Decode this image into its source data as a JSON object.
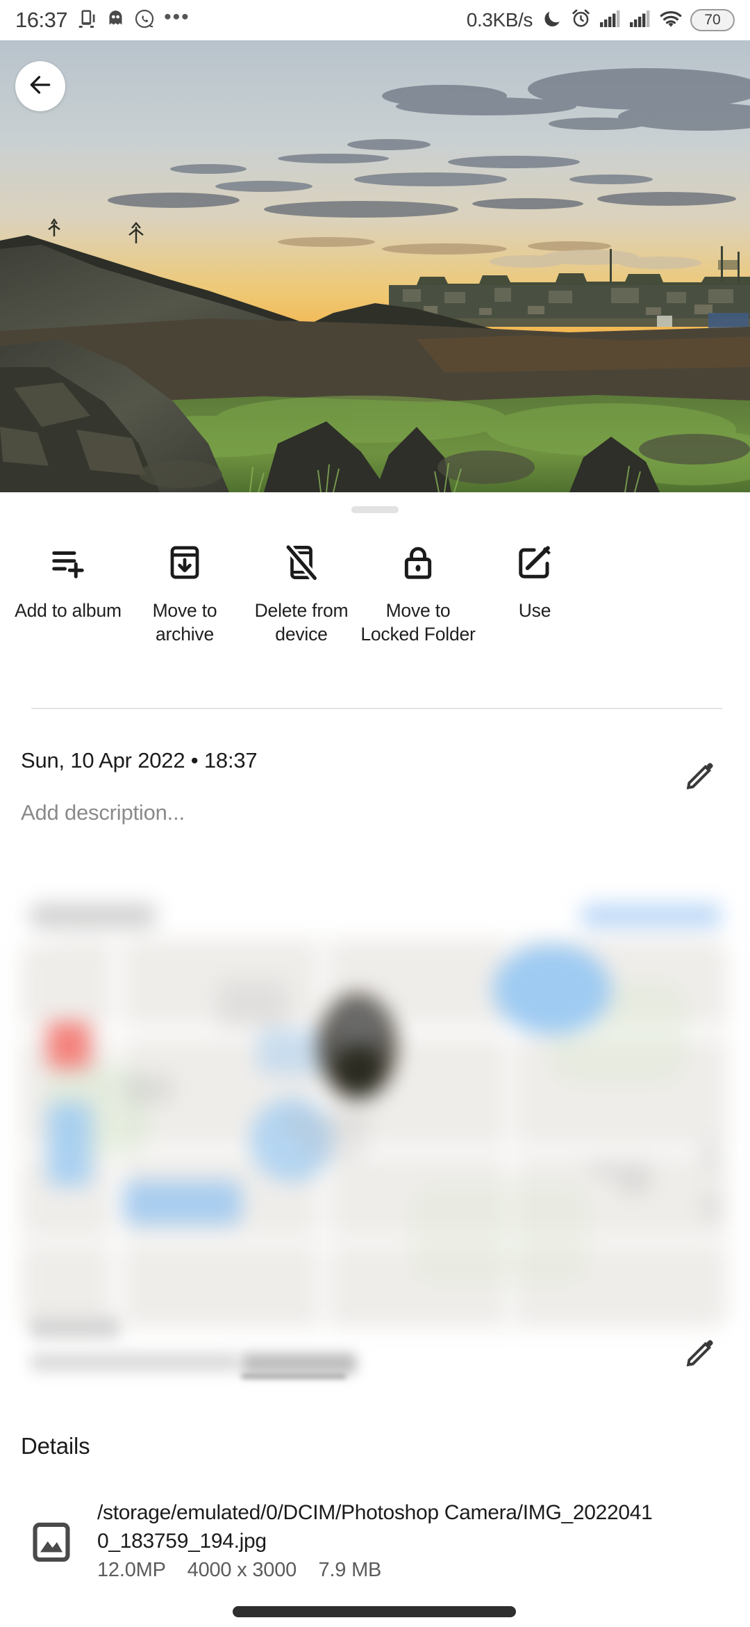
{
  "statusbar": {
    "clock": "16:37",
    "network_speed": "0.3KB/s",
    "battery": "70",
    "icons": [
      "cast-icon",
      "ghost-icon",
      "whatsapp-icon",
      "more-dots-icon",
      "dnd-moon-icon",
      "alarm-clock-icon",
      "signal-bars-sim1-icon",
      "signal-bars-sim2-icon",
      "wifi-icon",
      "battery-pill"
    ]
  },
  "photo": {
    "back_button": "back-arrow-icon",
    "description": "Sunset landscape over rocky quarry with town on horizon"
  },
  "sheet": {
    "handle": "drag-handle"
  },
  "actions": [
    {
      "label": "Add to album",
      "icon": "playlist-add-icon"
    },
    {
      "label": "Move to archive",
      "icon": "archive-download-icon"
    },
    {
      "label": "Delete from device",
      "icon": "phone-slash-icon"
    },
    {
      "label": "Move to Locked Folder",
      "icon": "lock-icon"
    },
    {
      "label": "Use",
      "icon": "use-as-edit-icon"
    }
  ],
  "info": {
    "date": "Sun, 10 Apr 2022  •  18:37",
    "description_placeholder": "Add description...",
    "edit_date_icon": "pencil-icon",
    "edit_location_icon": "pencil-icon"
  },
  "details": {
    "heading": "Details",
    "file_icon": "image-file-icon",
    "path": "/storage/emulated/0/DCIM/Photoshop Camera/IMG_20220410_183759_194.jpg",
    "meta": "12.0MP    4000 x 3000    7.9 MB"
  },
  "colors": {
    "background": "#ffffff",
    "text_primary": "#1b1b1b",
    "text_secondary": "#5c5c5c",
    "placeholder": "#8a8a8a",
    "divider": "#e4e4e4",
    "handle": "#e2e2e2",
    "gesture_bar": "#2e2e2e"
  }
}
